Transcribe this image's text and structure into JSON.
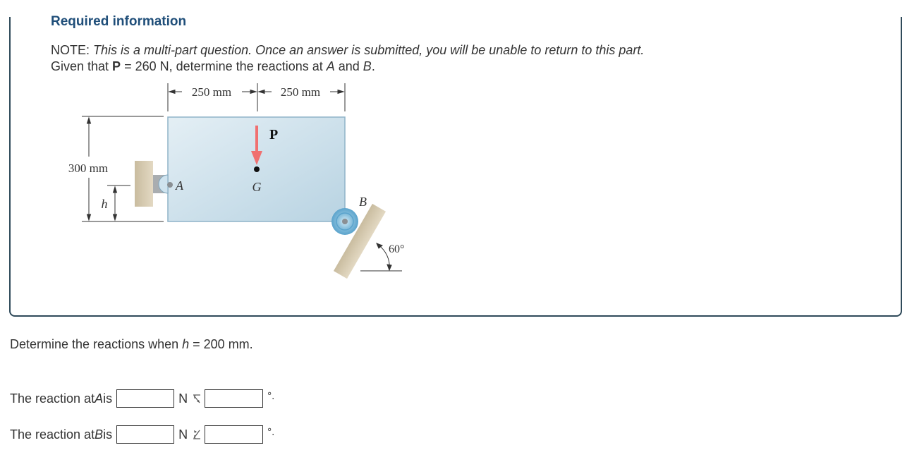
{
  "header": {
    "title": "Required information",
    "note_label": "NOTE:",
    "note_text": "This is a multi-part question. Once an answer is submitted, you will be unable to return to this part.",
    "given_prefix": "Given that ",
    "given_var": "P",
    "given_value": " = 260 N, determine the reactions at ",
    "given_a": "A",
    "given_and": " and ",
    "given_b": "B",
    "given_end": "."
  },
  "diagram": {
    "dim_left": "250 mm",
    "dim_right": "250 mm",
    "dim_height": "300 mm",
    "dim_h": "h",
    "label_P": "P",
    "label_A": "A",
    "label_G": "G",
    "label_B": "B",
    "angle": "60°",
    "colors": {
      "plate": "#c9dfea",
      "plate_border": "#8fb3c8",
      "force_arrow": "#f07070",
      "support": "#d8ccb2",
      "roller": "#7fb6d4"
    }
  },
  "question": {
    "prefix": "Determine the reactions when ",
    "var": "h",
    "suffix": " = 200 mm."
  },
  "answers": [
    {
      "prefix": "The reaction at ",
      "point": "A",
      "suffix": " is",
      "magnitude_value": "",
      "unit": "N",
      "angle_icon": "angle-down-right-icon",
      "angle_value": "",
      "degree": "°."
    },
    {
      "prefix": "The reaction at ",
      "point": "B",
      "suffix": " is",
      "magnitude_value": "",
      "unit": "N",
      "angle_icon": "angle-up-left-icon",
      "angle_value": "",
      "degree": "°."
    }
  ]
}
